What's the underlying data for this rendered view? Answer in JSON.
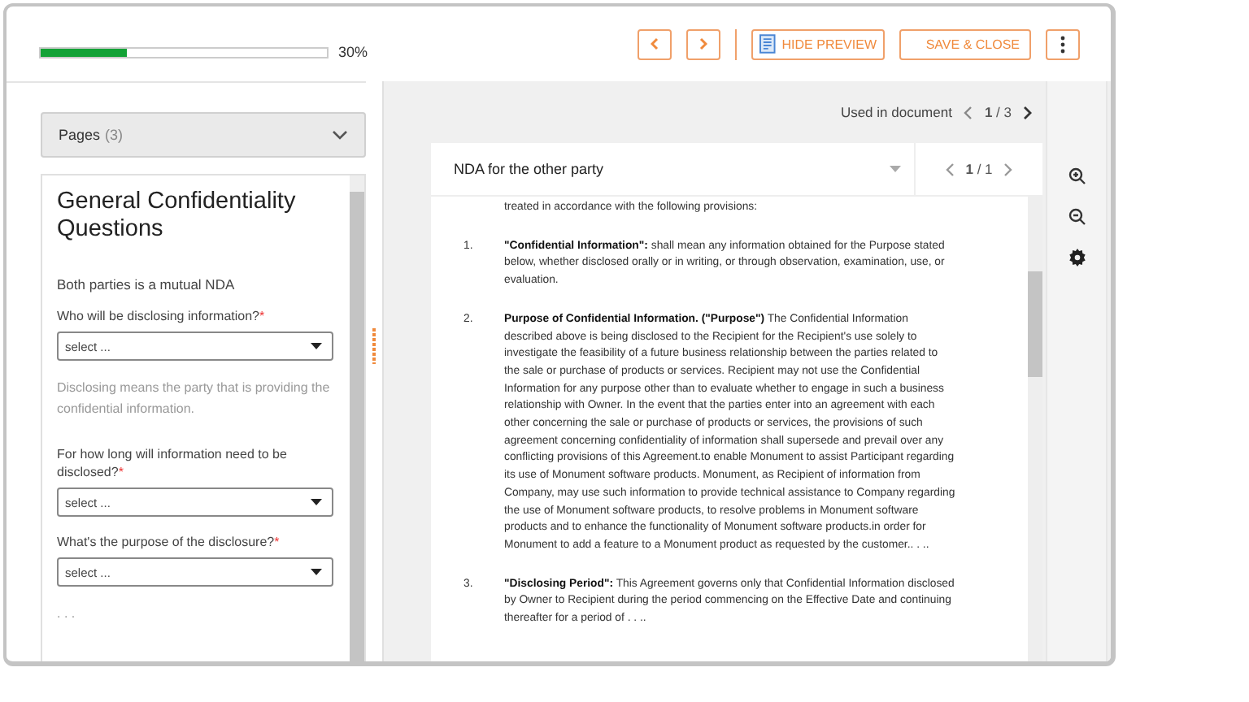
{
  "progress": {
    "level": 0.3,
    "label": "30%"
  },
  "toolbar": [
    {
      "kind": "back"
    },
    {
      "kind": "forward"
    },
    {
      "kind": "divider"
    },
    {
      "kind": "preview",
      "label": "HIDE PREVIEW"
    },
    {
      "kind": "save",
      "label": "SAVE & CLOSE"
    },
    {
      "kind": "more"
    }
  ],
  "pages_panel": {
    "title": "Pages",
    "count": "(3)"
  },
  "form": {
    "title": "General Confidentiality Questions",
    "items": [
      {
        "kind": "text",
        "text": "Both parties is a mutual NDA"
      },
      {
        "kind": "select",
        "label": "Who will be disclosing information?",
        "required_mark": "*",
        "placeholder": "select ..."
      },
      {
        "kind": "hint",
        "text": "Disclosing means the party that is providing the confidential information."
      },
      {
        "kind": "select",
        "label": "For how long will information need to be disclosed?",
        "required_mark": "*",
        "placeholder": "select ..."
      },
      {
        "kind": "select",
        "label": "What's the purpose of the disclosure?",
        "required_mark": "*",
        "placeholder": "select ..."
      },
      {
        "kind": "hint",
        "text": ". . ."
      }
    ]
  },
  "preview": {
    "used_label": "Used in document",
    "pager": "**1** / 3",
    "document": {
      "title": "NDA for the other party",
      "pager": "**1** / 1",
      "intro": "treated in accordance with the following provisions:",
      "clauses": [
        {
          "number": "1.",
          "text": "**\"Confidential Information\":** shall mean any information obtained for the Purpose stated below, whether disclosed orally or in writing, or through observation, examination, use, or evaluation."
        },
        {
          "number": "2.",
          "text": "**Purpose of Confidential Information. (\"Purpose\")** The Confidential Information described above is being disclosed to the Recipient for the Recipient's use solely to investigate the feasibility of a future business relationship between the parties related to the sale or purchase of products or services. Recipient may not use the Confidential Information for any purpose other than to evaluate whether to engage in such a business relationship with Owner. In the event that the parties enter into an agreement with each other concerning the sale or purchase of products or services, the provisions of such agreement concerning confidentiality of information shall supersede and prevail over any conflicting provisions of this Agreement.to enable Monument to assist Participant regarding its use of Monument software products. Monument, as Recipient of information from Company, may use such information to provide technical assistance to Company regarding the use of Monument software products, to resolve problems in Monument software products and to enhance the functionality of Monument software products.in order for Monument to add a feature to a Monument product as requested by the customer.. . .."
        },
        {
          "number": "3.",
          "text": "**\"Disclosing Period\":** This Agreement governs only that Confidential Information disclosed by Owner to Recipient during the period commencing on the Effective Date and continuing thereafter for a period of  . . .."
        }
      ]
    }
  }
}
